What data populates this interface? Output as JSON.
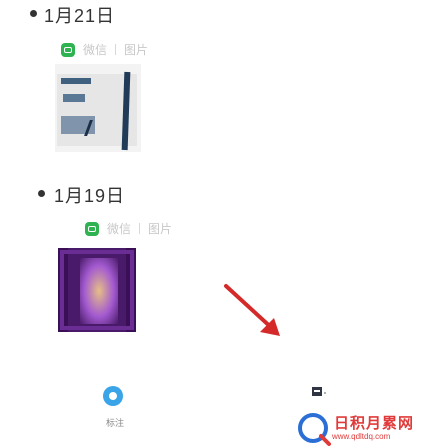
{
  "entries": [
    {
      "date": "1月21日",
      "source": "微信",
      "tag": "图片"
    },
    {
      "date": "1月19日",
      "source": "微信",
      "tag": "图片"
    }
  ],
  "footer": {
    "button_label": "标注"
  },
  "watermark": {
    "title": "日积月累网",
    "url": "www.qdltdq.com"
  },
  "colors": {
    "source_icon": "#2fb350",
    "arrow": "#d42a2a",
    "button": "#3aa4e8",
    "watermark": "#e03a3a"
  }
}
